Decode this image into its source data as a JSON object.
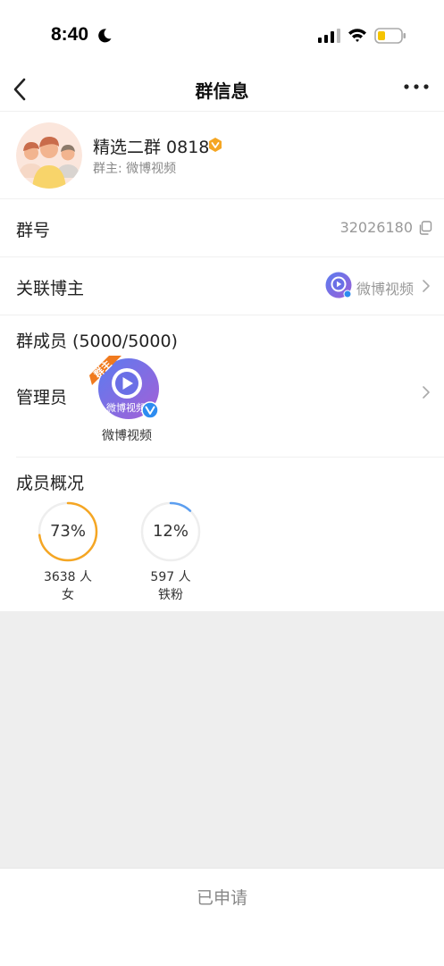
{
  "status_bar": {
    "time": "8:40"
  },
  "nav": {
    "title": "群信息"
  },
  "group": {
    "name": "精选二群 0818",
    "owner": "群主: 微博视频"
  },
  "rows": {
    "group_number_label": "群号",
    "group_number_value": "32026180",
    "linked_blogger_label": "关联博主",
    "linked_blogger_name": "微博视频",
    "members_label": "群成员 (5000/5000)",
    "admin_label": "管理员"
  },
  "admin": {
    "badge": "群主",
    "avatar_text": "微博视频",
    "name": "微博视频"
  },
  "overview": {
    "title": "成员概况",
    "stats": [
      {
        "percent_text": "73%",
        "fraction": 0.73,
        "count": "3638 人",
        "label": "女",
        "color": "#f5a623"
      },
      {
        "percent_text": "12%",
        "fraction": 0.12,
        "count": "597 人",
        "label": "铁粉",
        "color": "#5b9ef0"
      }
    ]
  },
  "bottom": {
    "button_label": "已申请"
  },
  "colors": {
    "accent_orange": "#f5a623",
    "accent_blue": "#5b9ef0",
    "background_gray": "#eeeeee",
    "weibo_video_purple": "#7a63d8"
  }
}
